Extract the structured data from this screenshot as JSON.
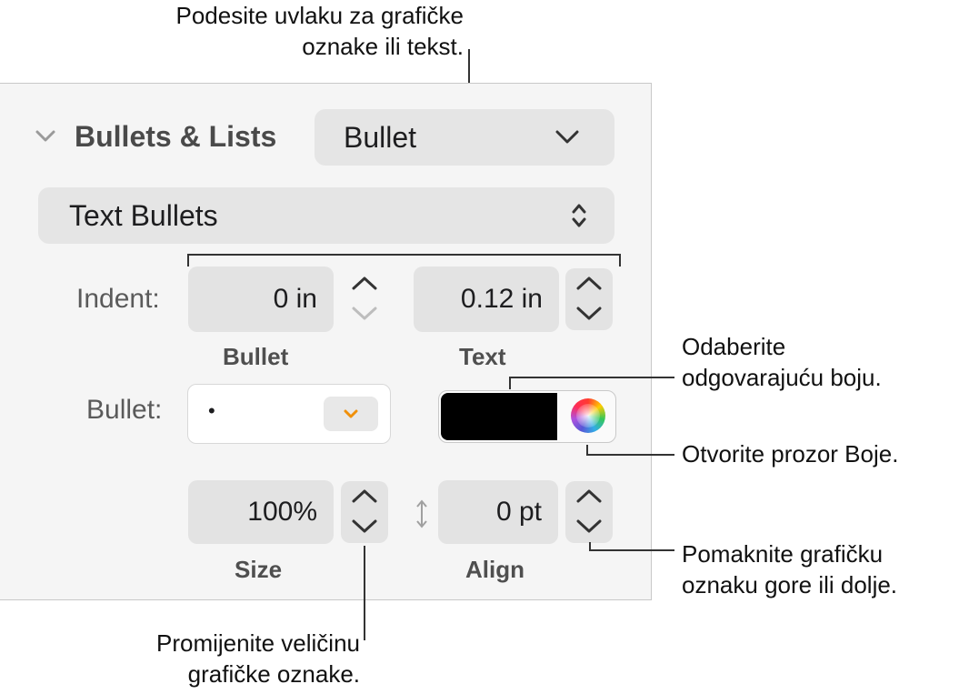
{
  "callouts": {
    "indent_line1": "Podesite uvlaku za grafičke",
    "indent_line2": "oznake ili tekst.",
    "color_line1": "Odaberite",
    "color_line2": "odgovarajuću boju.",
    "colors_window": "Otvorite prozor Boje.",
    "move_line1": "Pomaknite grafičku",
    "move_line2": "oznaku gore ili dolje.",
    "size_line1": "Promijenite veličinu",
    "size_line2": "grafičke oznake."
  },
  "section": {
    "title": "Bullets & Lists",
    "list_style": "Bullet",
    "bullet_type": "Text Bullets"
  },
  "indent": {
    "label": "Indent:",
    "bullet_value": "0 in",
    "text_value": "0.12 in",
    "bullet_caption": "Bullet",
    "text_caption": "Text"
  },
  "bullet": {
    "label": "Bullet:",
    "char": "•",
    "color": "#000000",
    "dropdown_accent": "#f0900a"
  },
  "size": {
    "value": "100%",
    "caption": "Size"
  },
  "align": {
    "value": "0 pt",
    "caption": "Align"
  }
}
